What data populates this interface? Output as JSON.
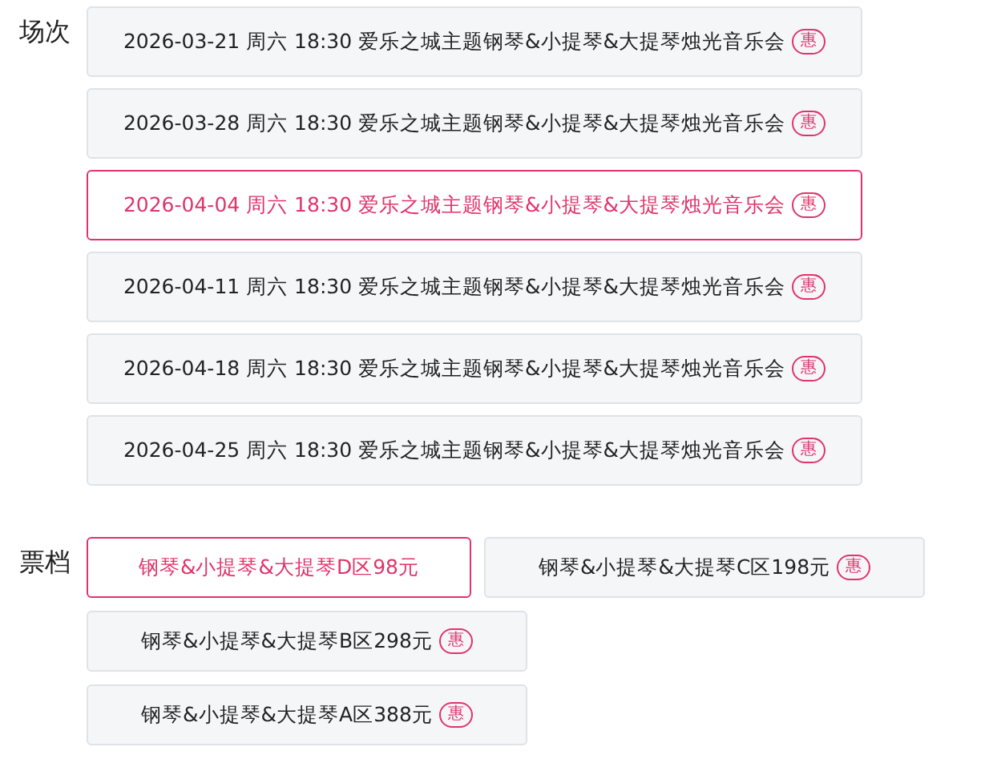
{
  "sessions": {
    "label": "场次",
    "items": [
      {
        "text": "2026-03-21 周六 18:30 爱乐之城主题钢琴&小提琴&大提琴烛光音乐会",
        "badge": "惠",
        "selected": false
      },
      {
        "text": "2026-03-28 周六 18:30 爱乐之城主题钢琴&小提琴&大提琴烛光音乐会",
        "badge": "惠",
        "selected": false
      },
      {
        "text": "2026-04-04 周六 18:30 爱乐之城主题钢琴&小提琴&大提琴烛光音乐会",
        "badge": "惠",
        "selected": true
      },
      {
        "text": "2026-04-11 周六 18:30 爱乐之城主题钢琴&小提琴&大提琴烛光音乐会",
        "badge": "惠",
        "selected": false
      },
      {
        "text": "2026-04-18 周六 18:30 爱乐之城主题钢琴&小提琴&大提琴烛光音乐会",
        "badge": "惠",
        "selected": false
      },
      {
        "text": "2026-04-25 周六 18:30 爱乐之城主题钢琴&小提琴&大提琴烛光音乐会",
        "badge": "惠",
        "selected": false
      }
    ]
  },
  "tickets": {
    "label": "票档",
    "items": [
      {
        "text": "钢琴&小提琴&大提琴D区98元",
        "selected": true
      },
      {
        "text": "钢琴&小提琴&大提琴C区198元",
        "badge": "惠",
        "selected": false
      },
      {
        "text": "钢琴&小提琴&大提琴B区298元",
        "badge": "惠",
        "selected": false
      },
      {
        "text": "钢琴&小提琴&大提琴A区388元",
        "badge": "惠",
        "selected": false
      }
    ]
  }
}
